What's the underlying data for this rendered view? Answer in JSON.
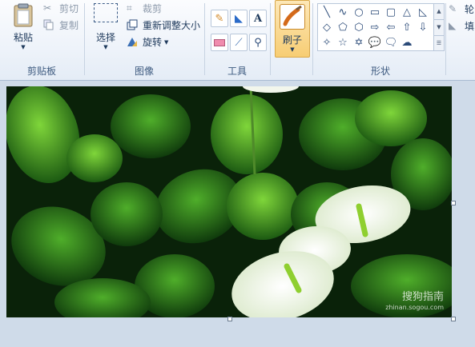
{
  "clipboard": {
    "paste": "粘贴",
    "cut": "剪切",
    "copy": "复制",
    "label": "剪贴板"
  },
  "image_group": {
    "select": "选择",
    "crop": "裁剪",
    "resize": "重新调整大小",
    "rotate": "旋转",
    "label": "图像"
  },
  "tools": {
    "label": "工具",
    "text_glyph": "A"
  },
  "brushes": {
    "label": "刷子"
  },
  "shapes": {
    "label": "形状",
    "items": [
      "╲",
      "∿",
      "○",
      "▭",
      "▢",
      "△",
      "◺",
      "◇",
      "⬠",
      "⬡",
      "⇨",
      "⇦",
      "⇧",
      "⇩",
      "✧",
      "☆",
      "✡",
      "💬",
      "🗨",
      "☁"
    ]
  },
  "extra": {
    "outline": "轮",
    "fill": "填"
  },
  "canvas": {
    "watermark": "搜狗指南",
    "watermark_sub": "zhinan.sogou.com",
    "accent": "#f7d282"
  }
}
